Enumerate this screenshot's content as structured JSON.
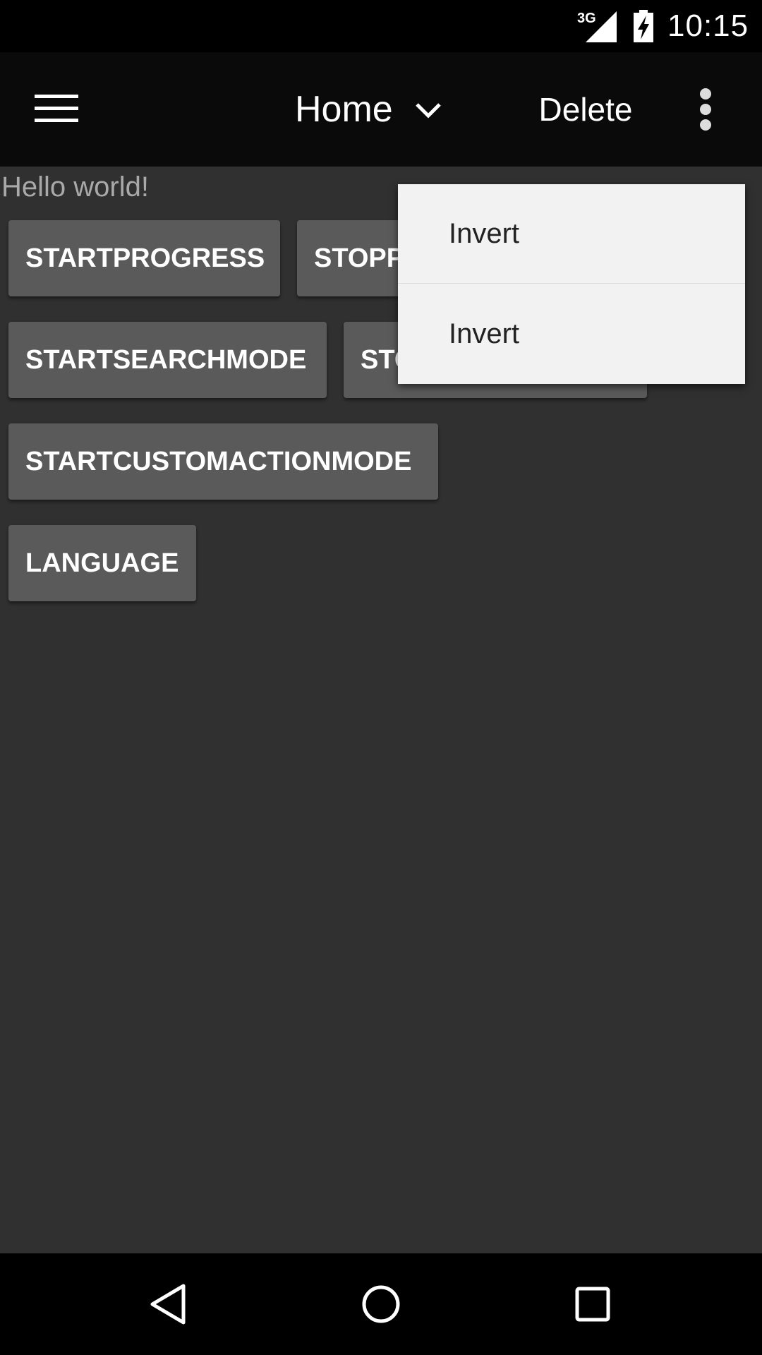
{
  "status_bar": {
    "network": "3G",
    "time": "10:15"
  },
  "app_bar": {
    "spinner_label": "Home",
    "delete_label": "Delete"
  },
  "content": {
    "hello_text": "Hello world!",
    "buttons": [
      "STARTPROGRESS",
      "STOPPROGRESS",
      "STARTSEARCHMODE",
      "STOPSEARCHMODE",
      "STARTCUSTOMACTIONMODE",
      "LANGUAGE"
    ]
  },
  "popup_menu": {
    "items": [
      "Invert",
      "Invert"
    ]
  },
  "icons": {
    "menu": "hamburger-menu-icon",
    "spinner": "chevron-down-icon",
    "overflow": "more-vert-icon",
    "signal": "signal-icon",
    "battery": "battery-charging-icon",
    "nav_back": "back-triangle-icon",
    "nav_home": "home-circle-icon",
    "nav_recents": "recents-square-icon"
  }
}
